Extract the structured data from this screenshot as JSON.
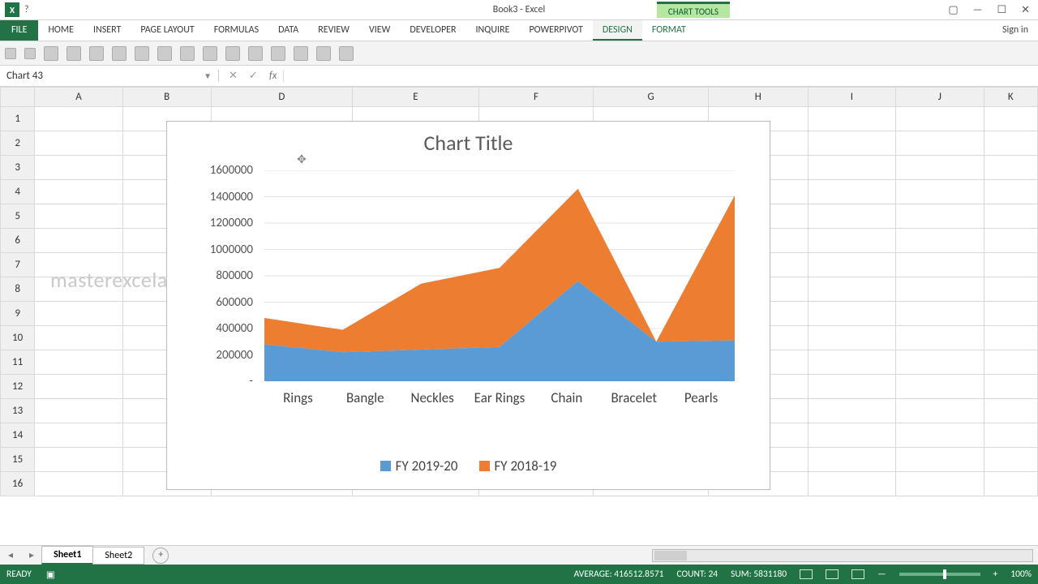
{
  "app": {
    "title": "Book3 - Excel",
    "chart_tools_label": "CHART TOOLS",
    "sign_in": "Sign in"
  },
  "tabs": {
    "file": "FILE",
    "home": "HOME",
    "insert": "INSERT",
    "page_layout": "PAGE LAYOUT",
    "formulas": "FORMULAS",
    "data": "DATA",
    "review": "REVIEW",
    "view": "VIEW",
    "developer": "DEVELOPER",
    "inquire": "INQUIRE",
    "powerpivot": "POWERPIVOT",
    "design": "DESIGN",
    "format": "FORMAT"
  },
  "namebox": {
    "value": "Chart 43"
  },
  "columns": [
    "A",
    "B",
    "D",
    "E",
    "F",
    "G",
    "H",
    "I",
    "J",
    "K"
  ],
  "rows": [
    "1",
    "2",
    "3",
    "4",
    "5",
    "6",
    "7",
    "8",
    "9",
    "10",
    "11",
    "12",
    "13",
    "14",
    "15",
    "16"
  ],
  "watermark": "masterexcelae@gmail.com",
  "sheets": {
    "active": "Sheet1",
    "other": "Sheet2"
  },
  "status": {
    "ready": "READY",
    "average": "AVERAGE: 416512.8571",
    "count": "COUNT: 24",
    "sum": "SUM: 5831180",
    "zoom": "100%"
  },
  "chart_data": {
    "type": "area",
    "stacked": true,
    "title": "Chart Title",
    "categories": [
      "Rings",
      "Bangle",
      "Neckles",
      "Ear Rings",
      "Chain",
      "Bracelet",
      "Pearls"
    ],
    "series": [
      {
        "name": "FY 2019-20",
        "color": "#5b9bd5",
        "values": [
          280000,
          220000,
          240000,
          260000,
          760000,
          300000,
          310000
        ]
      },
      {
        "name": "FY 2018-19",
        "color": "#ed7d31",
        "values": [
          200000,
          170000,
          500000,
          600000,
          700000,
          0,
          1100000
        ]
      }
    ],
    "ylim": [
      0,
      1600000
    ],
    "ystep": 200000,
    "yticks": [
      "1600000",
      "1400000",
      "1200000",
      "1000000",
      "800000",
      "600000",
      "400000",
      "200000",
      "-"
    ]
  }
}
